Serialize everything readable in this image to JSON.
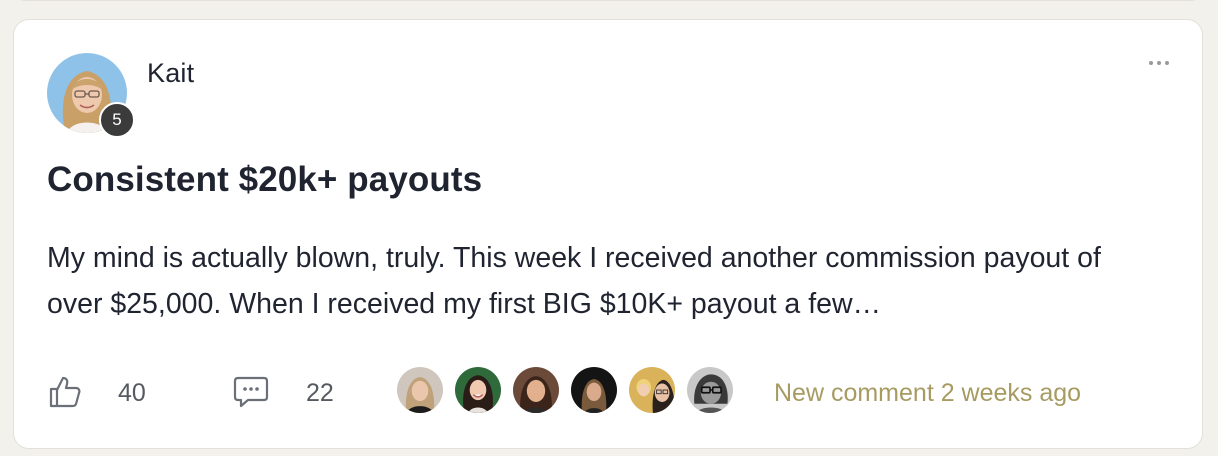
{
  "post": {
    "author": {
      "name": "Kait",
      "level": "5",
      "avatar_icon": "user-avatar"
    },
    "more_icon": "ellipsis-icon",
    "title": "Consistent $20k+ payouts",
    "body": "My mind is actually blown, truly. This week I received another commission payout of over $25,000. When I received my first BIG $10K+ payout a few…",
    "likes": "40",
    "comments": "22",
    "last_activity": "New comment 2 weeks ago",
    "colors": {
      "accent": "#a79b62",
      "text": "#1f2430",
      "muted": "#555a61",
      "badge": "#3b3b3b"
    }
  }
}
